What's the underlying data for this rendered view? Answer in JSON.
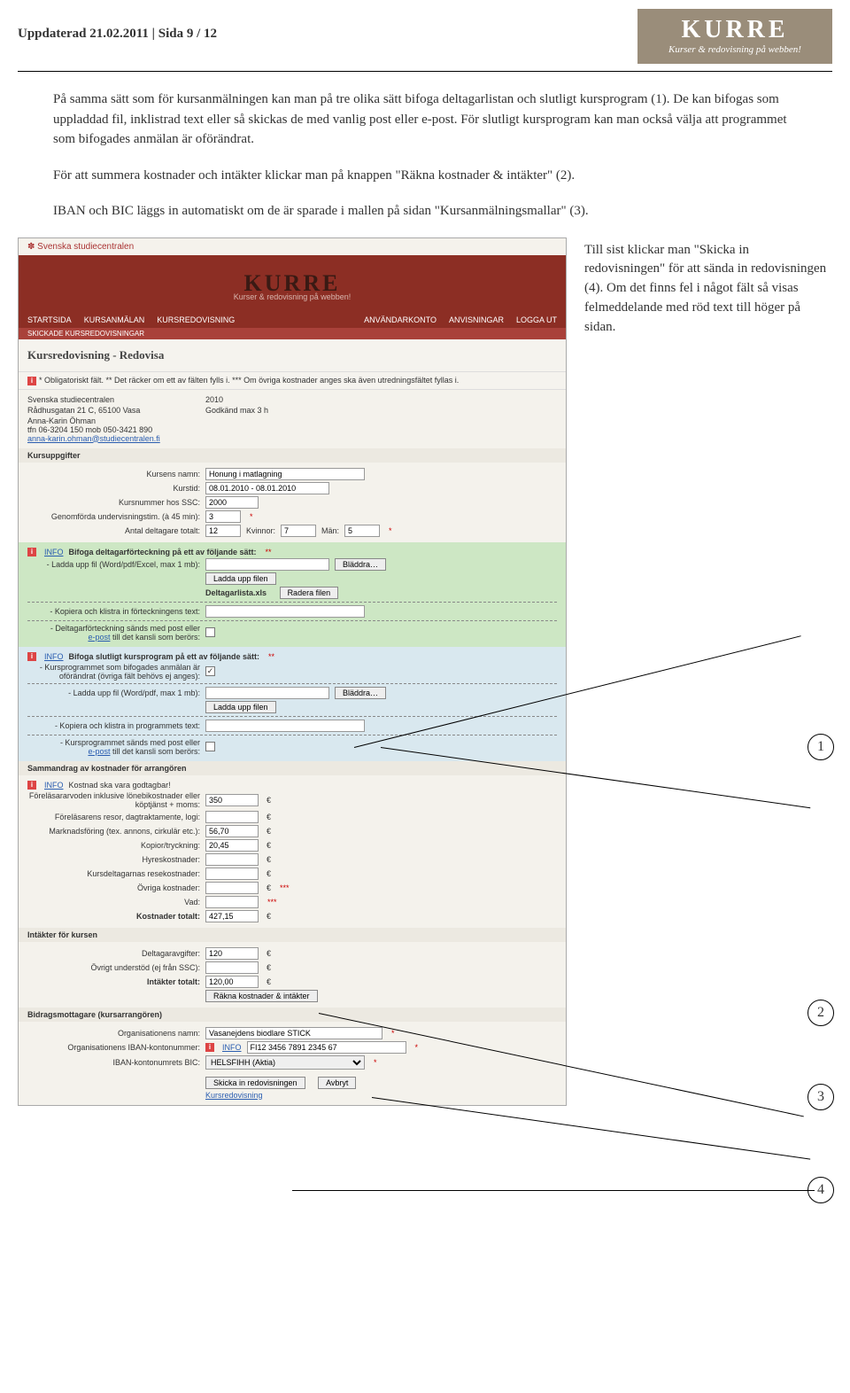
{
  "header": {
    "updated": "Uppdaterad 21.02.2011 | Sida 9 / 12",
    "logo_big": "KURRE",
    "logo_small": "Kurser & redovisning på webben!"
  },
  "para1": "På samma sätt som för kursanmälningen kan man på tre olika sätt bifoga deltagarlistan och slutligt kursprogram (1). De kan bifogas som uppladdad fil, inklistrad text eller så skickas de med vanlig post eller e-post. För slutligt kursprogram kan man också välja att programmet som bifogades anmälan är oförändrat.",
  "para2": "För att summera kostnader och intäkter klickar man på knappen \"Räkna kostnader & intäkter\" (2).",
  "para3": "IBAN och BIC läggs in automatiskt om de är sparade i mallen på sidan \"Kursanmälningsmallar\" (3).",
  "side": "Till sist klickar man \"Skicka in redovisningen\" för att sända in redovisningen (4). Om det finns fel i något fält så visas felmeddelande med röd text till höger på sidan.",
  "app": {
    "top_org": "Svenska studiecentralen",
    "banner_logo": "KURRE",
    "banner_sub": "Kurser & redovisning på webben!",
    "nav_left": [
      "STARTSIDA",
      "KURSANMÄLAN",
      "KURSREDOVISNING"
    ],
    "nav_right": [
      "ANVÄNDARKONTO",
      "ANVISNINGAR",
      "LOGGA UT"
    ],
    "subnav": "SKICKADE KURSREDOVISNINGAR",
    "title": "Kursredovisning - Redovisa",
    "legend": "* Obligatoriskt fält.   ** Det räcker om ett av fälten fylls i.   *** Om övriga kostnader anges ska även utredningsfältet fyllas i.",
    "org_block": {
      "org": "Svenska studiecentralen",
      "year": "2010",
      "addr": "Rådhusgatan 21 C, 65100 Vasa",
      "approved": "Godkänd max 3 h",
      "contact1": "Anna-Karin Öhman",
      "contact2": "tfn 06-3204 150   mob 050-3421 890",
      "email": "anna-karin.ohman@studiecentralen.fi"
    },
    "sections": {
      "kurs_hdr": "Kursuppgifter",
      "kurs_name_lbl": "Kursens namn:",
      "kurs_name": "Honung i matlagning",
      "kurstid_lbl": "Kurstid:",
      "kurstid": "08.01.2010 - 08.01.2010",
      "kursnr_lbl": "Kursnummer hos SSC:",
      "kursnr": "2000",
      "tim_lbl": "Genomförda undervisningstim. (à 45 min):",
      "tim": "3",
      "delt_lbl": "Antal deltagare totalt:",
      "delt": "12",
      "kvinnor_lbl": "Kvinnor:",
      "kvinnor": "7",
      "man_lbl": "Män:",
      "man": "5",
      "INFO": "INFO",
      "bifoga_delt": "Bifoga deltagarförteckning på ett av följande sätt:",
      "ladda_lbl": "- Ladda upp fil (Word/pdf/Excel, max 1 mb):",
      "bladdra": "Bläddra…",
      "ladda_btn": "Ladda upp filen",
      "file": "Deltagarlista.xls",
      "radera": "Radera filen",
      "klistra_lbl": "- Kopiera och klistra in förteckningens text:",
      "post_lbl": "- Deltagarförteckning sänds med post eller",
      "epost": "e-post",
      "till": " till det kansli som berörs:",
      "bifoga_prog": "Bifoga slutligt kursprogram på ett av följande sätt:",
      "prog_same": "- Kursprogrammet som bifogades anmälan är oförändrat (övriga fält behövs ej anges):",
      "prog_upload": "- Ladda upp fil (Word/pdf, max 1 mb):",
      "prog_paste": "- Kopiera och klistra in programmets text:",
      "prog_post": "- Kursprogrammet sänds med post eller",
      "prog_till": " till det kansli som berörs:",
      "kost_hdr": "Sammandrag av kostnader för arrangören",
      "kost_info": "Kostnad ska vara godtagbar!",
      "k1": "Föreläsararvoden inklusive lönebikostnader eller köptjänst + moms:",
      "k1v": "350",
      "k2": "Föreläsarens resor, dagtraktamente, logi:",
      "k2v": "",
      "k3": "Marknadsföring (tex. annons, cirkulär etc.):",
      "k3v": "56,70",
      "k4": "Kopior/tryckning:",
      "k4v": "20,45",
      "k5": "Hyreskostnader:",
      "k5v": "",
      "k6": "Kursdeltagarnas resekostnader:",
      "k6v": "",
      "k7": "Övriga kostnader:",
      "k7v": "",
      "vad": "Vad:",
      "vadv": "",
      "ktot_lbl": "Kostnader totalt:",
      "ktot": "427,15",
      "int_hdr": "Intäkter för kursen",
      "i1": "Deltagaravgifter:",
      "i1v": "120",
      "i2": "Övrigt understöd (ej från SSC):",
      "i2v": "",
      "itot_lbl": "Intäkter totalt:",
      "itot": "120,00",
      "rakna": "Räkna kostnader & intäkter",
      "bidr_hdr": "Bidragsmottagare (kursarrangören)",
      "orgn_lbl": "Organisationens namn:",
      "orgn": "Vasanejdens biodlare STICK",
      "iban_lbl": "Organisationens IBAN-kontonummer:",
      "iban": "FI12 3456 7891 2345 67",
      "bic_lbl": "IBAN-kontonumrets BIC:",
      "bic": "HELSFIHH (Aktia)",
      "skicka": "Skicka in redovisningen",
      "avbryt": "Avbryt",
      "back": "Kursredovisning",
      "euro": "€"
    }
  },
  "callouts": {
    "c1": "1",
    "c2": "2",
    "c3": "3",
    "c4": "4"
  }
}
